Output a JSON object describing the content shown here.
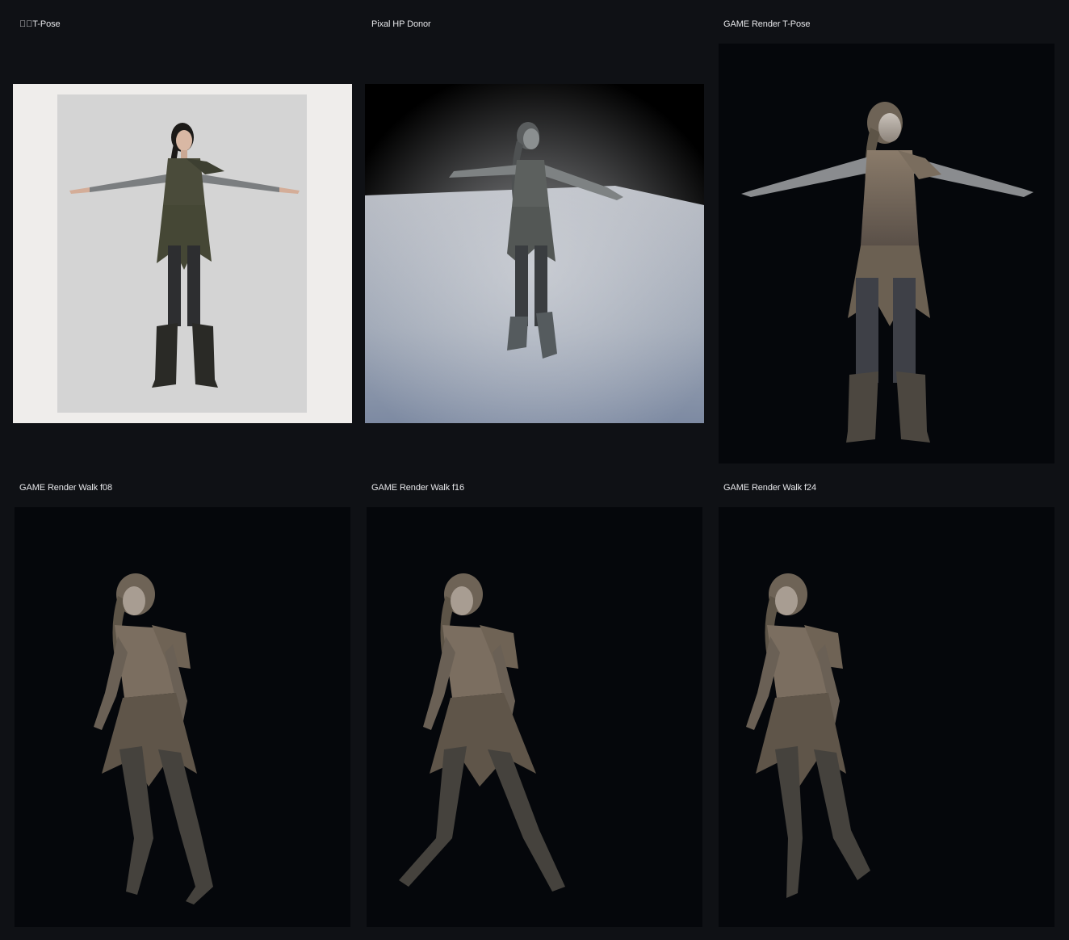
{
  "panels": [
    {
      "label": "\u0000\u0000T-Pose"
    },
    {
      "label": "Pixal HP Donor"
    },
    {
      "label": "GAME Render T-Pose"
    },
    {
      "label": "GAME Render Walk f08"
    },
    {
      "label": "GAME Render Walk f16"
    },
    {
      "label": "GAME Render Walk f24"
    }
  ]
}
